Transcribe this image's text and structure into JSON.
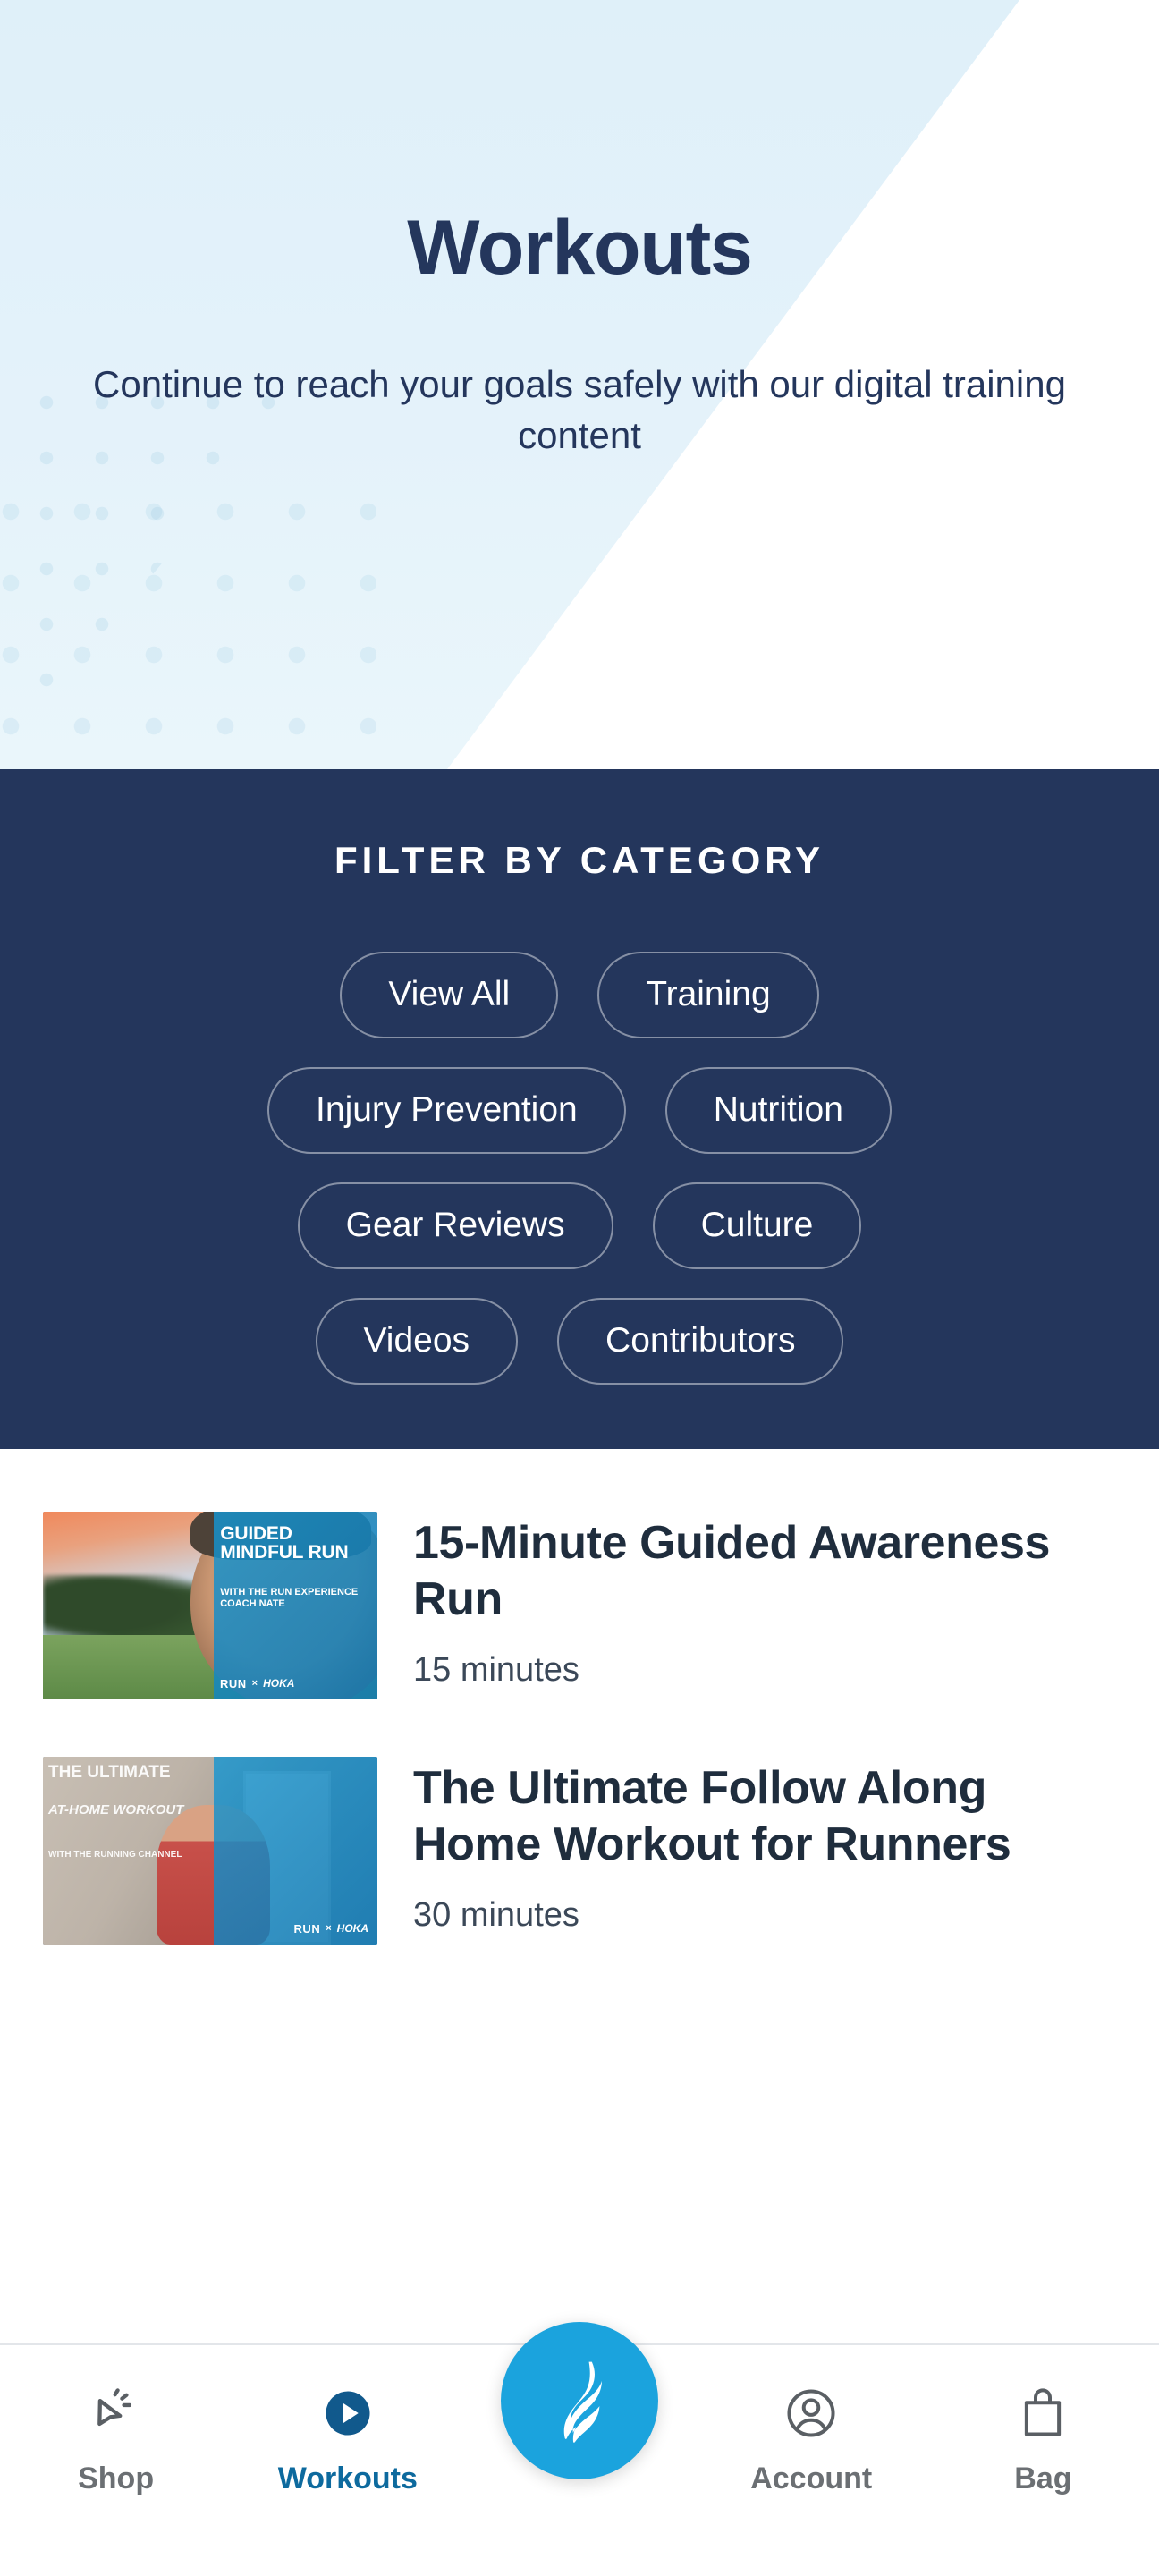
{
  "header": {
    "title": "Workouts",
    "subtitle": "Continue to reach your goals safely with our digital training content"
  },
  "filter": {
    "heading": "FILTER BY CATEGORY",
    "chips": [
      "View All",
      "Training",
      "Injury Prevention",
      "Nutrition",
      "Gear Reviews",
      "Culture",
      "Videos",
      "Contributors"
    ]
  },
  "workouts": [
    {
      "title": "15-Minute Guided Awareness Run",
      "duration": "15 minutes",
      "thumbnail_overlay": {
        "headline": "GUIDED MINDFUL RUN",
        "subline": "WITH THE RUN EXPERIENCE COACH NATE",
        "brand_left": "RUN",
        "brand_sep": "×",
        "brand_right": "HOKA"
      }
    },
    {
      "title": "The Ultimate Follow Along Home Workout for Runners",
      "duration": "30 minutes",
      "thumbnail_overlay": {
        "headline": "THE ULTIMATE",
        "subline": "AT-HOME WORKOUT",
        "subline2": "WITH THE RUNNING CHANNEL",
        "brand_left": "RUN",
        "brand_sep": "×",
        "brand_right": "HOKA"
      }
    }
  ],
  "tabbar": {
    "items": [
      {
        "label": "Shop",
        "icon": "cursor-click-icon",
        "active": false
      },
      {
        "label": "Workouts",
        "icon": "play-circle-icon",
        "active": true
      },
      {
        "label": "Account",
        "icon": "user-circle-icon",
        "active": false
      },
      {
        "label": "Bag",
        "icon": "shopping-bag-icon",
        "active": false
      }
    ],
    "fab_icon": "flame-logo-icon"
  },
  "colors": {
    "navy": "#24365c",
    "hero_blue": "#dff0f9",
    "accent_cyan": "#1ba3dd",
    "active_blue": "#0d6a9e",
    "inactive_gray": "#6b6f73"
  }
}
